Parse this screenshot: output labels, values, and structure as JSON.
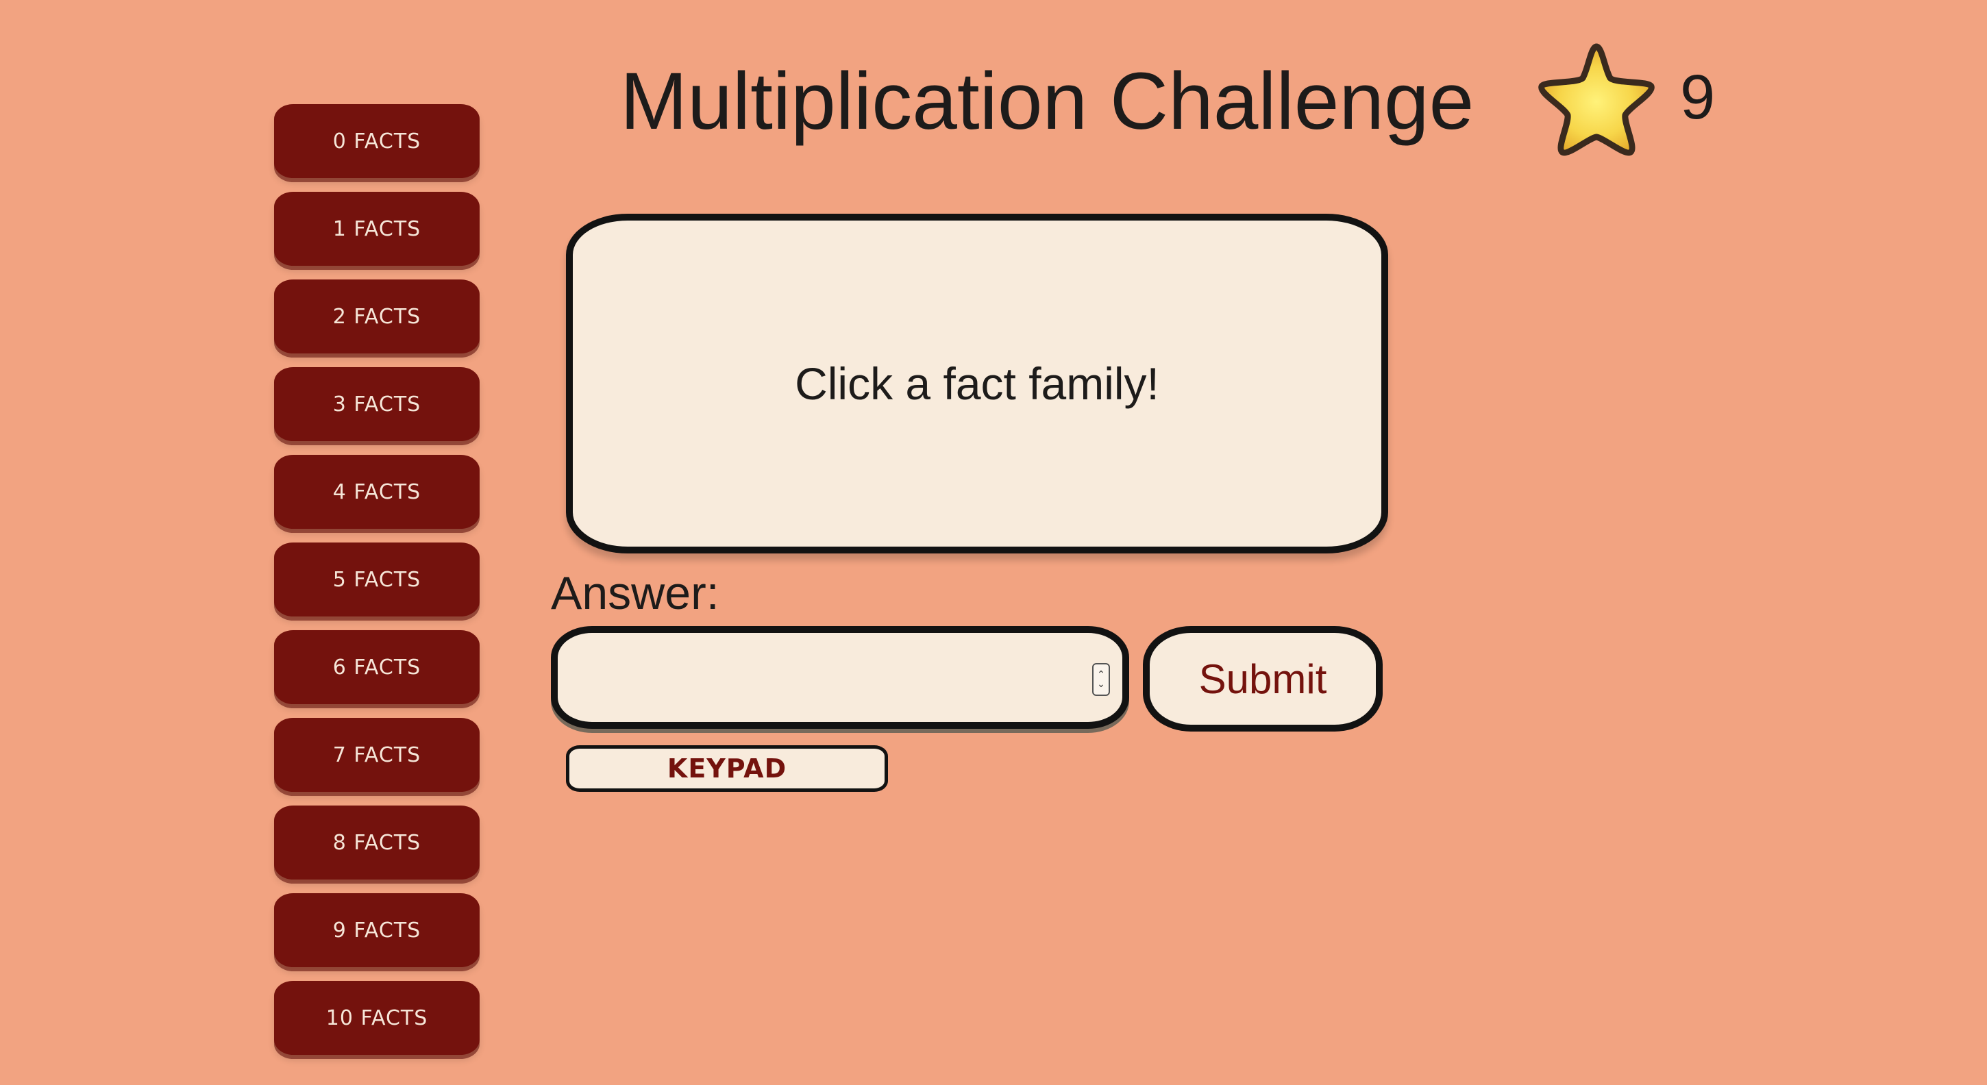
{
  "header": {
    "title": "Multiplication Challenge",
    "score": "9",
    "score_icon": "star-icon"
  },
  "sidebar": {
    "facts": [
      {
        "label": "0 FACTS"
      },
      {
        "label": "1 FACTS"
      },
      {
        "label": "2 FACTS"
      },
      {
        "label": "3 FACTS"
      },
      {
        "label": "4 FACTS"
      },
      {
        "label": "5 FACTS"
      },
      {
        "label": "6 FACTS"
      },
      {
        "label": "7 FACTS"
      },
      {
        "label": "8 FACTS"
      },
      {
        "label": "9 FACTS"
      },
      {
        "label": "10 FACTS"
      }
    ]
  },
  "card": {
    "prompt": "Click a fact family!"
  },
  "answer": {
    "label": "Answer:",
    "value": "",
    "placeholder": ""
  },
  "buttons": {
    "submit_label": "Submit",
    "keypad_label": "KEYPAD"
  },
  "colors": {
    "background": "#f2a381",
    "fact_button": "#74120d",
    "card": "#f8ebdc",
    "accent_text": "#74120d"
  }
}
